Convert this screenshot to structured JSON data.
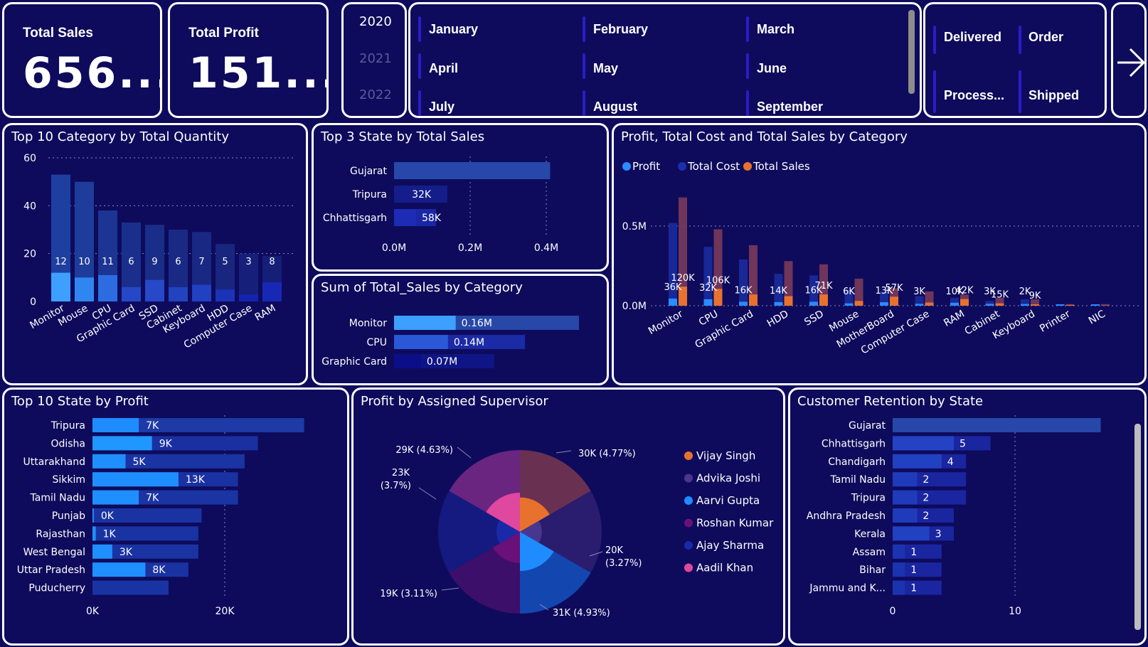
{
  "kpis": {
    "sales": {
      "label": "Total Sales",
      "value": "656...."
    },
    "profit": {
      "label": "Total Profit",
      "value": "151...."
    }
  },
  "years": [
    {
      "label": "2020",
      "selected": true
    },
    {
      "label": "2021",
      "selected": false
    },
    {
      "label": "2022",
      "selected": false
    }
  ],
  "months": [
    "January",
    "February",
    "March",
    "April",
    "May",
    "June",
    "July",
    "August",
    "September"
  ],
  "statuses": [
    "Delivered",
    "Order",
    "Process...",
    "Shipped"
  ],
  "nav_arrow_icon": "arrow-right-icon",
  "colors": {
    "background": "#0e0b5c",
    "border": "#ffffff",
    "light_blue": "#3d9fff",
    "mid_blue": "#2748b8",
    "dark_blue": "#1a25a8",
    "orange": "#e8712e"
  },
  "chart_data": [
    {
      "type": "bar",
      "title": "Top 10 Category by Total Quantity",
      "categories": [
        "Monitor",
        "Mouse",
        "CPU",
        "Graphic Card",
        "SSD",
        "Cabinet",
        "Keyboard",
        "HDD",
        "Computer Case",
        "RAM"
      ],
      "totals": [
        53,
        50,
        38,
        33,
        32,
        30,
        29,
        24,
        20,
        19
      ],
      "values": [
        12,
        10,
        11,
        6,
        9,
        6,
        7,
        5,
        3,
        8
      ],
      "data_labels": [
        "12",
        "10",
        "11",
        "6",
        "9",
        "6",
        "7",
        "5",
        "3",
        "8"
      ],
      "ylim": [
        0,
        60
      ],
      "yticks": [
        "0",
        "20",
        "40",
        "60"
      ]
    },
    {
      "type": "bar",
      "orientation": "horizontal",
      "title": "Top 3 State by Total Sales",
      "categories": [
        "Gujarat",
        "Tripura",
        "Chhattisgarh"
      ],
      "totals": [
        0.41,
        0.14,
        0.11
      ],
      "values": [
        0.41,
        0.032,
        0.058
      ],
      "data_labels": [
        "",
        "32K",
        "58K"
      ],
      "xlim": [
        0,
        0.45
      ],
      "xticks": [
        "0.0M",
        "0.2M",
        "0.4M"
      ]
    },
    {
      "type": "bar",
      "orientation": "horizontal",
      "title": "Sum of Total_Sales by Category",
      "categories": [
        "Monitor",
        "CPU",
        "Graphic Card"
      ],
      "totals": [
        0.48,
        0.34,
        0.26
      ],
      "values": [
        0.16,
        0.14,
        0.07
      ],
      "data_labels": [
        "0.16M",
        "0.14M",
        "0.07M"
      ],
      "xlim": [
        0,
        0.5
      ]
    },
    {
      "type": "bar",
      "title": "Profit, Total Cost and Total Sales by Category",
      "legend": [
        "Profit",
        "Total Cost",
        "Total Sales"
      ],
      "categories": [
        "Monitor",
        "CPU",
        "Graphic Card",
        "HDD",
        "SSD",
        "Mouse",
        "MotherBoard",
        "Computer Case",
        "RAM",
        "Cabinet",
        "Keyboard",
        "Printer",
        "NIC"
      ],
      "x_tick_labels": [
        "Monitor",
        "CPU",
        "Graphic Card",
        "HDD",
        "SSD",
        "Mouse",
        "MotherBoard",
        "Computer Case",
        "RAM",
        "Cabinet",
        "Keyboard",
        "Printer",
        "NIC"
      ],
      "series": [
        {
          "name": "Profit",
          "values": [
            0.036,
            0.032,
            0.016,
            0.014,
            0.016,
            0.006,
            0.013,
            0.003,
            0.01,
            0.003,
            0.002,
            0.0,
            0.0
          ]
        },
        {
          "name": "Total Cost",
          "values": [
            0.52,
            0.37,
            0.29,
            0.2,
            0.19,
            0.1,
            0.09,
            0.06,
            0.05,
            0.03,
            0.04,
            0.01,
            0.0
          ]
        },
        {
          "name": "Total Sales",
          "values": [
            0.12,
            0.106,
            0.071,
            0.06,
            0.071,
            0.03,
            0.057,
            0.02,
            0.042,
            0.015,
            0.009,
            0.005,
            0.002
          ]
        },
        {
          "name": "Total Sales bg",
          "values": [
            0.68,
            0.48,
            0.38,
            0.28,
            0.26,
            0.17,
            0.11,
            0.09,
            0.07,
            0.05,
            0.04,
            0.01,
            0.01
          ]
        }
      ],
      "data_labels": [
        {
          "cat": 0,
          "text": "36K",
          "s": 0
        },
        {
          "cat": 0,
          "text": "120K",
          "s": 2
        },
        {
          "cat": 1,
          "text": "32K",
          "s": 0
        },
        {
          "cat": 1,
          "text": "106K",
          "s": 2
        },
        {
          "cat": 2,
          "text": "16K",
          "s": 0
        },
        {
          "cat": 3,
          "text": "14K",
          "s": 0
        },
        {
          "cat": 4,
          "text": "16K",
          "s": 0
        },
        {
          "cat": 4,
          "text": "71K",
          "s": 2
        },
        {
          "cat": 5,
          "text": "6K",
          "s": 0
        },
        {
          "cat": 6,
          "text": "13K",
          "s": 0
        },
        {
          "cat": 6,
          "text": "57K",
          "s": 2
        },
        {
          "cat": 7,
          "text": "3K",
          "s": 0
        },
        {
          "cat": 8,
          "text": "10K",
          "s": 0
        },
        {
          "cat": 8,
          "text": "42K",
          "s": 2
        },
        {
          "cat": 9,
          "text": "3K",
          "s": 0
        },
        {
          "cat": 9,
          "text": "15K",
          "s": 2
        },
        {
          "cat": 10,
          "text": "2K",
          "s": 0
        },
        {
          "cat": 10,
          "text": "9K",
          "s": 2
        }
      ],
      "ylim": [
        0,
        0.7
      ],
      "yticks": [
        {
          "value": 0,
          "label": "0.0M"
        },
        {
          "value": 0.5,
          "label": "0.5M"
        }
      ]
    },
    {
      "type": "bar",
      "orientation": "horizontal",
      "title": "Top 10 State by Profit",
      "categories": [
        "Tripura",
        "Odisha",
        "Uttarakhand",
        "Sikkim",
        "Tamil Nadu",
        "Punjab",
        "Rajasthan",
        "West Bengal",
        "Uttar Pradesh",
        "Puducherry"
      ],
      "totals": [
        32,
        25,
        23,
        22,
        22,
        16.5,
        16,
        16,
        14.5,
        11.5
      ],
      "values": [
        7,
        9,
        5,
        13,
        7,
        0.2,
        0.5,
        3,
        8,
        0
      ],
      "data_labels": [
        "7K",
        "9K",
        "5K",
        "13K",
        "7K",
        "0K",
        "1K",
        "3K",
        "8K",
        ""
      ],
      "xlim": [
        0,
        33
      ],
      "xticks": [
        {
          "value": 0,
          "label": "0K"
        },
        {
          "value": 20,
          "label": "20K"
        }
      ]
    },
    {
      "type": "pie",
      "title": "Profit by Assigned Supervisor",
      "legend": [
        "Vijay Singh",
        "Advika Joshi",
        "Aarvi Gupta",
        "Roshan Kumar",
        "Ajay Sharma",
        "Aadil Khan"
      ],
      "slices": [
        {
          "name": "Vijay Singh",
          "value": 30,
          "label": "30K (4.77%)",
          "inner": 0.88
        },
        {
          "name": "Advika Joshi",
          "value": 20,
          "label": "20K (3.27%)",
          "inner": 0.56
        },
        {
          "name": "Aarvi Gupta",
          "value": 31,
          "label": "31K (4.93%)",
          "inner": 1.0
        },
        {
          "name": "Roshan Kumar",
          "value": 19,
          "label": "19K (3.11%)",
          "inner": 0.8
        },
        {
          "name": "Ajay Sharma",
          "value": 23,
          "label": "23K (3.7%)",
          "inner": 0.6
        },
        {
          "name": "Aadil Khan",
          "value": 29,
          "label": "29K (4.63%)",
          "inner": 1.0
        }
      ]
    },
    {
      "type": "bar",
      "orientation": "horizontal",
      "title": "Customer Retention by State",
      "categories": [
        "Gujarat",
        "Chhattisgarh",
        "Chandigarh",
        "Tamil Nadu",
        "Tripura",
        "Andhra Pradesh",
        "Kerala",
        "Assam",
        "Bihar",
        "Jammu and K..."
      ],
      "totals": [
        17,
        8,
        6,
        6,
        6,
        5,
        5,
        4,
        4,
        4
      ],
      "values": [
        17,
        5,
        4,
        2,
        2,
        2,
        3,
        1,
        1,
        1
      ],
      "data_labels": [
        "",
        "5",
        "4",
        "2",
        "2",
        "2",
        "3",
        "1",
        "1",
        "1"
      ],
      "xlim": [
        0,
        17.5
      ],
      "xticks": [
        {
          "value": 0,
          "label": "0"
        },
        {
          "value": 10,
          "label": "10"
        }
      ]
    }
  ]
}
